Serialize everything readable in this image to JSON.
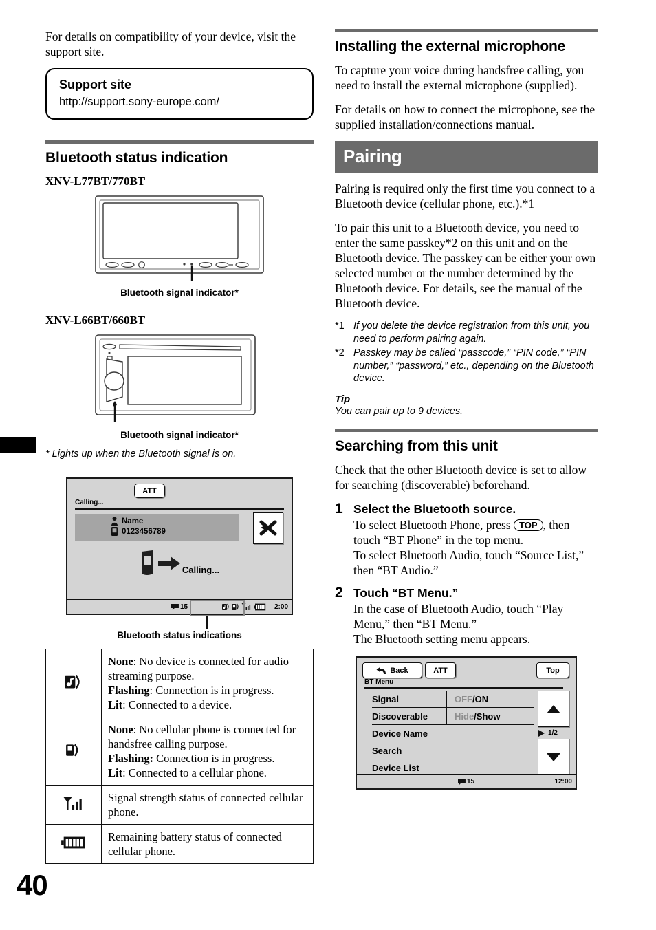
{
  "page": {
    "number": "40"
  },
  "left_column": {
    "intro_paragraph": "For details on compatibility of your device, visit the support site.",
    "support_box": {
      "title": "Support site",
      "url": "http://support.sony-europe.com/"
    },
    "section_heading": "Bluetooth status indication",
    "model_a": {
      "heading": "XNV-L77BT/770BT",
      "caption": "Bluetooth signal indicator*"
    },
    "model_b": {
      "heading": "XNV-L66BT/660BT",
      "caption": "Bluetooth signal indicator*"
    },
    "asterisk_note": "* Lights up when the Bluetooth signal is on.",
    "call_screen": {
      "att_label": "ATT",
      "status_label": "Calling...",
      "contact_name": "Name",
      "contact_number": "0123456789",
      "end_call_icon": "end-call-icon",
      "calling_label": "Calling...",
      "message_count": "15",
      "clock": "2:00",
      "icons": [
        "bt-audio-icon",
        "bt-phone-icon",
        "signal-strength-icon",
        "battery-icon"
      ],
      "caption": "Bluetooth status indications"
    },
    "status_table": {
      "rows": [
        {
          "icon": "bt-audio-icon",
          "lines": [
            {
              "label": "None",
              "text": ": No device is connected for audio streaming purpose."
            },
            {
              "label": "Flashing",
              "text": ": Connection is in progress."
            },
            {
              "label": "Lit",
              "text": ": Connected to a device."
            }
          ]
        },
        {
          "icon": "bt-phone-icon",
          "lines": [
            {
              "label": "None",
              "text": ": No cellular phone is connected for handsfree calling purpose."
            },
            {
              "label": "Flashing:",
              "text": " Connection is in progress."
            },
            {
              "label": "Lit",
              "text": ": Connected to a cellular phone."
            }
          ]
        },
        {
          "icon": "signal-strength-icon",
          "lines": [
            {
              "label": "",
              "text": "Signal strength status of connected cellular phone."
            }
          ]
        },
        {
          "icon": "battery-icon",
          "lines": [
            {
              "label": "",
              "text": "Remaining battery status of connected cellular phone."
            }
          ]
        }
      ]
    }
  },
  "right_column": {
    "mic_section": {
      "heading": "Installing the external microphone",
      "paragraph_1": "To capture your voice during handsfree calling, you need to install the external microphone (supplied).",
      "paragraph_2": "For details on how to connect the microphone, see the supplied installation/connections manual."
    },
    "pairing_section": {
      "bar_title": "Pairing",
      "paragraph_1": "Pairing is required only the first time you connect to a Bluetooth device (cellular phone, etc.).*1",
      "paragraph_2": "To pair this unit to a Bluetooth device, you need to enter the same passkey*2 on this unit and on the Bluetooth device. The passkey can be either your own selected number or the number determined by the Bluetooth device. For details, see the manual of the Bluetooth device.",
      "footnotes": [
        {
          "mark": "*1",
          "text": "If you delete the device registration from this unit, you need to perform pairing again."
        },
        {
          "mark": "*2",
          "text": "Passkey may be called “passcode,” “PIN code,” “PIN number,” “password,” etc., depending on the Bluetooth device."
        }
      ],
      "tip_heading": "Tip",
      "tip_text": "You can pair up to 9 devices."
    },
    "searching_section": {
      "heading": "Searching from this unit",
      "intro": "Check that the other Bluetooth device is set to allow for searching (discoverable) beforehand.",
      "steps": [
        {
          "number": "1",
          "title": "Select the Bluetooth source.",
          "text_before_key": "To select Bluetooth Phone, press ",
          "key_label": "TOP",
          "text_after_key": ", then touch “BT Phone” in the top menu.",
          "text_extra": "To select Bluetooth Audio, touch “Source List,” then “BT Audio.”"
        },
        {
          "number": "2",
          "title": "Touch “BT Menu.”",
          "text_before_key": "In the case of Bluetooth Audio, touch “Play Menu,” then “BT Menu.”",
          "key_label": "",
          "text_after_key": "",
          "text_extra": "The Bluetooth setting menu appears."
        }
      ]
    },
    "bt_menu_screen": {
      "back_label": "Back",
      "att_label": "ATT",
      "top_label": "Top",
      "menu_title": "BT Menu",
      "rows": [
        {
          "name": "Signal",
          "value_off": "OFF",
          "value_sep": " / ",
          "value_on": "ON",
          "has_arrow": false
        },
        {
          "name": "Discoverable",
          "value_off": "Hide",
          "value_sep": " / ",
          "value_on": "Show",
          "has_arrow": false
        },
        {
          "name": "Device Name",
          "value_off": "",
          "value_sep": "",
          "value_on": "",
          "has_arrow": true
        },
        {
          "name": "Search",
          "value_off": "",
          "value_sep": "",
          "value_on": "",
          "has_arrow": true
        },
        {
          "name": "Device List",
          "value_off": "",
          "value_sep": "",
          "value_on": "",
          "has_arrow": true
        }
      ],
      "page_indicator": "1/2",
      "message_count": "15",
      "clock": "12:00"
    }
  },
  "colors": {
    "rule": "#6b6b6b",
    "section_bar": "#6b6b6b",
    "screen_bg": "#d4d4d4",
    "contact_bar": "#a5a5a5",
    "dim_text": "#8e8e8e"
  }
}
